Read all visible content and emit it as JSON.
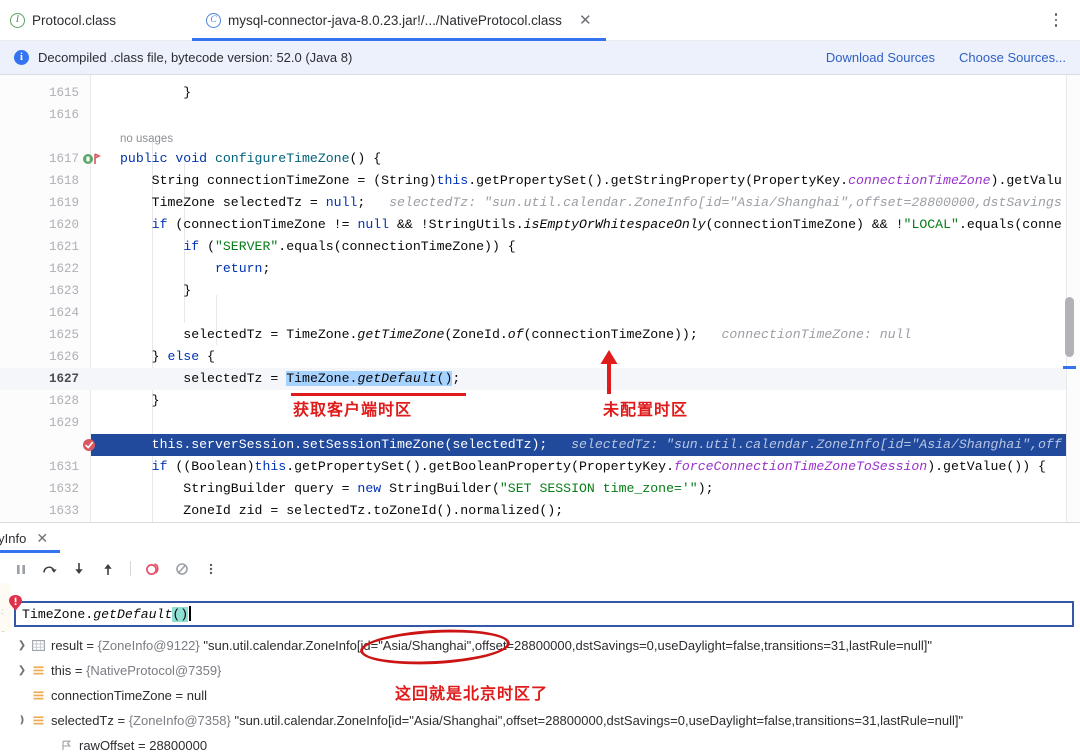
{
  "tabs": [
    {
      "label": "Protocol.class",
      "icon": "interface-icon",
      "icon_letter": "I",
      "active": false,
      "closable": false
    },
    {
      "label": "mysql-connector-java-8.0.23.jar!/.../NativeProtocol.class",
      "icon": "class-icon",
      "icon_letter": "C",
      "active": true,
      "closable": true
    }
  ],
  "tab_overflow_icon": "more-options-kebab-icon",
  "notification": {
    "icon": "info-icon",
    "message": "Decompiled .class file, bytecode version: 52.0 (Java 8)",
    "links": [
      "Download Sources",
      "Choose Sources..."
    ]
  },
  "editor": {
    "lines": [
      {
        "num": "1615",
        "text": "        }"
      },
      {
        "num": "1616",
        "text": ""
      },
      {
        "num": "",
        "text": "no usages",
        "kind": "inlay"
      },
      {
        "num": "1617",
        "text": "public void configureTimeZone() {",
        "gutter_icon": "run-method-icon"
      },
      {
        "num": "1618",
        "text": "String connectionTimeZone = (String)this.getPropertySet().getStringProperty(PropertyKey.connectionTimeZone).getValue();"
      },
      {
        "num": "1619",
        "text": "TimeZone selectedTz = null;",
        "hint": "selectedTz: \"sun.util.calendar.ZoneInfo[id=\"Asia/Shanghai\",offset=28800000,dstSavings"
      },
      {
        "num": "1620",
        "text": "if (connectionTimeZone != null && !StringUtils.isEmptyOrWhitespaceOnly(connectionTimeZone) && !\"LOCAL\".equals(conne"
      },
      {
        "num": "1621",
        "text": "if (\"SERVER\".equals(connectionTimeZone)) {"
      },
      {
        "num": "1622",
        "text": "return;"
      },
      {
        "num": "1623",
        "text": "}"
      },
      {
        "num": "1624",
        "text": ""
      },
      {
        "num": "1625",
        "text": "selectedTz = TimeZone.getTimeZone(ZoneId.of(connectionTimeZone));",
        "hint": "connectionTimeZone: null"
      },
      {
        "num": "1626",
        "text": "} else {"
      },
      {
        "num": "1627",
        "text": "selectedTz = TimeZone.getDefault();",
        "current": true,
        "selection": "TimeZone.getDefault()"
      },
      {
        "num": "1628",
        "text": "}"
      },
      {
        "num": "1629",
        "text": ""
      },
      {
        "num": "1630",
        "text": "this.serverSession.setSessionTimeZone(selectedTz);",
        "hint": "selectedTz: \"sun.util.calendar.ZoneInfo[id=\"Asia/Shanghai\",off",
        "highlighted": true,
        "gutter_icon": "breakpoint-hit-icon"
      },
      {
        "num": "1631",
        "text": "if ((Boolean)this.getPropertySet().getBooleanProperty(PropertyKey.forceConnectionTimeZoneToSession).getValue()) {"
      },
      {
        "num": "1632",
        "text": "StringBuilder query = new StringBuilder(\"SET SESSION time_zone='\");"
      },
      {
        "num": "1633",
        "text": "ZoneId zid = selectedTz.toZoneId().normalized();"
      }
    ],
    "annotations": [
      {
        "id": "get-client-timezone",
        "text": "获取客户端时区",
        "kind": "underline-label"
      },
      {
        "id": "timezone-not-configured",
        "text": "未配置时区",
        "kind": "arrow-label"
      }
    ]
  },
  "bottom_panel": {
    "tab_label": "loyInfo",
    "tab_close_icon": "close-icon",
    "toolbar_buttons": [
      {
        "name": "pause-program-button",
        "icon": "pause-icon"
      },
      {
        "name": "step-over-button",
        "icon": "step-over-icon"
      },
      {
        "name": "step-into-button",
        "icon": "step-into-icon"
      },
      {
        "name": "step-out-button",
        "icon": "step-out-icon"
      },
      {
        "name": "mute-breakpoints-button",
        "icon": "mute-breakpoints-icon"
      },
      {
        "name": "no-breakpoint-button",
        "icon": "crossed-circle-icon"
      },
      {
        "name": "more-options-button",
        "icon": "kebab-icon"
      }
    ],
    "expression": {
      "value": "TimeZone.getDefault()",
      "selected_part": "()",
      "error_icon": "error-badge-icon"
    },
    "variables": [
      {
        "chevron": "collapsed",
        "icon": "result-icon",
        "name": "result",
        "ref": "{ZoneInfo@9122}",
        "value": "\"sun.util.calendar.ZoneInfo[id=\"Asia/Shanghai\",offset=28800000,dstSavings=0,useDaylight=false,transitions=31,lastRule=null]\""
      },
      {
        "chevron": "collapsed",
        "icon": "field-icon",
        "name": "this",
        "ref": "{NativeProtocol@7359}",
        "value": ""
      },
      {
        "chevron": "none",
        "icon": "field-icon",
        "name": "connectionTimeZone",
        "ref": "",
        "value": "null"
      },
      {
        "chevron": "expanded",
        "icon": "field-icon",
        "name": "selectedTz",
        "ref": "{ZoneInfo@7358}",
        "value": "\"sun.util.calendar.ZoneInfo[id=\"Asia/Shanghai\",offset=28800000,dstSavings=0,useDaylight=false,transitions=31,lastRule=null]\""
      },
      {
        "chevron": "none",
        "icon": "primitive-field-icon",
        "name": "rawOffset",
        "ref": "",
        "value": "28800000",
        "indent": 1
      }
    ],
    "annotation": {
      "id": "beijing-timezone-note",
      "text": "这回就是北京时区了"
    }
  },
  "colors": {
    "accent": "#3574f0",
    "annotation_red": "#e01b1b",
    "selection_blue": "#214a9c",
    "link_blue": "#2f5fc4",
    "keyword_blue": "#0033b3",
    "string_green": "#067d17",
    "property_purple": "#9a32cd"
  }
}
